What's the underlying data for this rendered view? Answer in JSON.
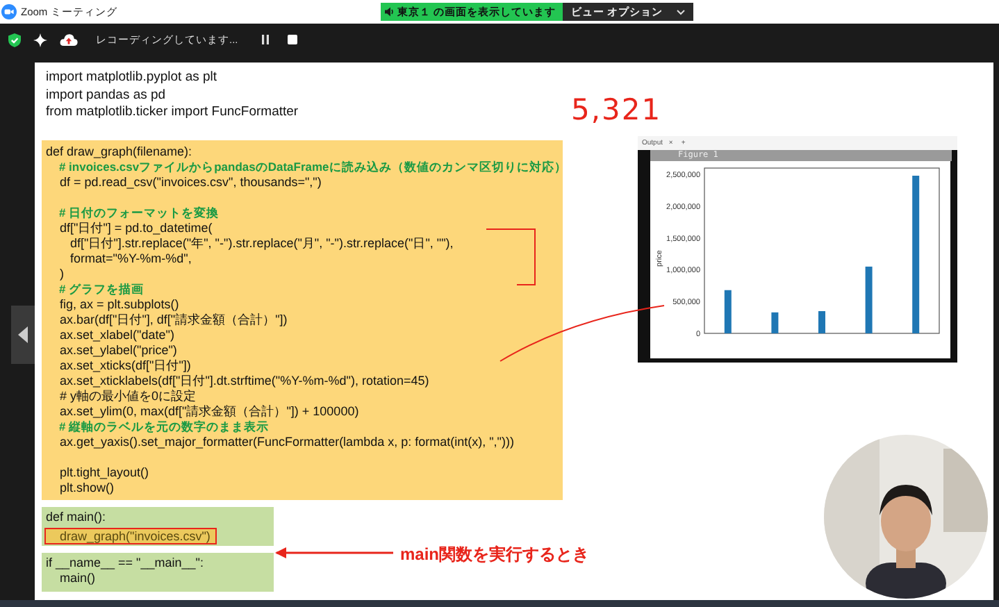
{
  "window": {
    "title": "Zoom ミーティング"
  },
  "share_banner": {
    "text": "東京１ の画面を表示しています"
  },
  "view_options": {
    "label": "ビュー オプション"
  },
  "toolbar": {
    "recording_status": "レコーディングしています..."
  },
  "slide": {
    "imports": [
      "import matplotlib.pyplot as plt",
      "import pandas as pd",
      "from matplotlib.ticker import FuncFormatter"
    ],
    "blocks": [
      {
        "kind": "yellow",
        "lines": [
          {
            "kind": "code",
            "text": "def draw_graph(filename):"
          },
          {
            "kind": "comment",
            "text": "    # invoices.csvファイルからpandasのDataFrameに読み込み（数値のカンマ区切りに対応）"
          },
          {
            "kind": "code",
            "text": "    df = pd.read_csv(\"invoices.csv\", thousands=\",\")"
          },
          {
            "kind": "blank"
          },
          {
            "kind": "comment",
            "text": "    # 日付のフォーマットを変換"
          },
          {
            "kind": "code",
            "text": "    df[\"日付\"] = pd.to_datetime("
          },
          {
            "kind": "code",
            "text": "       df[\"日付\"].str.replace(\"年\", \"-\").str.replace(\"月\", \"-\").str.replace(\"日\", \"\"),"
          },
          {
            "kind": "code",
            "text": "       format=\"%Y-%m-%d\","
          },
          {
            "kind": "code",
            "text": "    )"
          },
          {
            "kind": "comment",
            "text": "    # グラフを描画"
          },
          {
            "kind": "code",
            "text": "    fig, ax = plt.subplots()"
          },
          {
            "kind": "code",
            "text": "    ax.bar(df[\"日付\"], df[\"請求金額（合計）\"])"
          },
          {
            "kind": "code",
            "text": "    ax.set_xlabel(\"date\")"
          },
          {
            "kind": "code",
            "text": "    ax.set_ylabel(\"price\")"
          },
          {
            "kind": "code",
            "text": "    ax.set_xticks(df[\"日付\"])"
          },
          {
            "kind": "code",
            "text": "    ax.set_xticklabels(df[\"日付\"].dt.strftime(\"%Y-%m-%d\"), rotation=45)"
          },
          {
            "kind": "code",
            "text": "    # y軸の最小値を0に設定"
          },
          {
            "kind": "code",
            "text": "    ax.set_ylim(0, max(df[\"請求金額（合計）\"]) + 100000)"
          },
          {
            "kind": "comment",
            "text": "    # 縦軸のラベルを元の数字のまま表示"
          },
          {
            "kind": "code",
            "text": "    ax.get_yaxis().set_major_formatter(FuncFormatter(lambda x, p: format(int(x), \",\")))"
          },
          {
            "kind": "blank"
          },
          {
            "kind": "code",
            "text": "    plt.tight_layout()"
          },
          {
            "kind": "code",
            "text": "    plt.show()"
          }
        ]
      },
      {
        "kind": "green",
        "lines": [
          {
            "kind": "code",
            "text": "def main():"
          },
          {
            "kind": "highlight",
            "text": "    draw_graph(\"invoices.csv\")"
          }
        ]
      },
      {
        "kind": "green",
        "lines": [
          {
            "kind": "code",
            "text": "if __name__ == \"__main__\":"
          },
          {
            "kind": "code",
            "text": "    main()"
          }
        ]
      }
    ],
    "annotations": {
      "handwritten_number": "5,321",
      "arrow_label": "main関数を実行するとき"
    },
    "output_panel": {
      "tab": "Output",
      "close": "×",
      "add": "+",
      "figure": {
        "title": "Figure 1",
        "chart_data": {
          "type": "bar",
          "ylabel": "price",
          "categories": [
            null,
            null,
            null,
            null,
            null
          ],
          "ylim": [
            0,
            2600000
          ],
          "yticks": [
            {
              "value": 0,
              "label": "0"
            },
            {
              "value": 500000,
              "label": "500,000"
            },
            {
              "value": 1000000,
              "label": "1,000,000"
            },
            {
              "value": 1500000,
              "label": "1,500,000"
            },
            {
              "value": 2000000,
              "label": "2,000,000"
            },
            {
              "value": 2500000,
              "label": "2,500,000"
            }
          ],
          "series": [
            {
              "color": "#1f77b4",
              "values": [
                680000,
                330000,
                350000,
                1050000,
                2480000
              ]
            }
          ]
        }
      }
    }
  }
}
